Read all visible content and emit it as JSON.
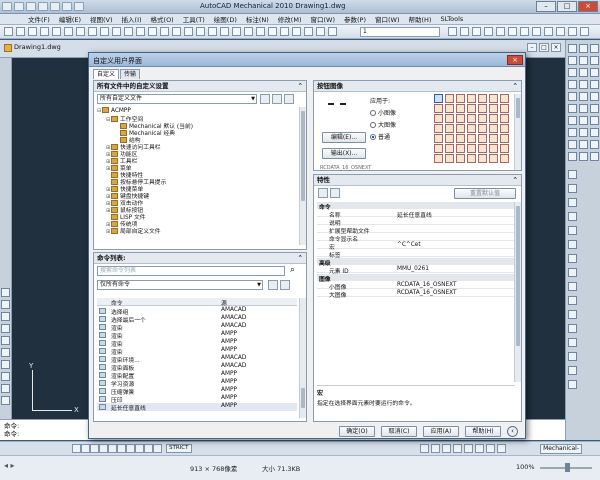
{
  "app": {
    "title": "AutoCAD Mechanical 2010   Drawing1.dwg",
    "search_placeholder": "",
    "menu": [
      "文件(F)",
      "编辑(E)",
      "视图(V)",
      "插入(I)",
      "格式(O)",
      "工具(T)",
      "绘图(D)",
      "标注(N)",
      "修改(M)",
      "窗口(W)",
      "参数(P)",
      "窗口(W)",
      "帮助(H)",
      "SLTools"
    ],
    "toolbar_combo": "1"
  },
  "document": {
    "tab": "Drawing1.dwg"
  },
  "command_line": {
    "lines": [
      "命令:",
      "命令:"
    ]
  },
  "status": {
    "coord": "",
    "strict": "STRICT",
    "model": "Mechanical-"
  },
  "viewer": {
    "dims": "913 × 768像素",
    "size": "大小 71.3KB",
    "zoom": "100%"
  },
  "dialog": {
    "title": "自定义用户界面",
    "tabs": [
      "自定义",
      "传输"
    ],
    "left_top": {
      "header": "所有文件中的自定义设置",
      "select": "所有自定义文件",
      "tree": [
        {
          "label": "ACMPP",
          "level": 0,
          "exp": "⊟"
        },
        {
          "label": "工作空间",
          "level": 1,
          "exp": "⊟"
        },
        {
          "label": "Mechanical 默认 (当前)",
          "level": 2,
          "exp": ""
        },
        {
          "label": "Mechanical 经典",
          "level": 2,
          "exp": ""
        },
        {
          "label": "结构",
          "level": 2,
          "exp": ""
        },
        {
          "label": "快速访问工具栏",
          "level": 1,
          "exp": "⊞"
        },
        {
          "label": "功能区",
          "level": 1,
          "exp": "⊞"
        },
        {
          "label": "工具栏",
          "level": 1,
          "exp": "⊞"
        },
        {
          "label": "菜单",
          "level": 1,
          "exp": "⊞"
        },
        {
          "label": "快捷特性",
          "level": 1,
          "exp": ""
        },
        {
          "label": "按标悬停工具提示",
          "level": 1,
          "exp": ""
        },
        {
          "label": "快捷菜单",
          "level": 1,
          "exp": "⊞"
        },
        {
          "label": "键盘快捷键",
          "level": 1,
          "exp": "⊞"
        },
        {
          "label": "双击动作",
          "level": 1,
          "exp": "⊞"
        },
        {
          "label": "鼠标按钮",
          "level": 1,
          "exp": "⊞"
        },
        {
          "label": "LISP 文件",
          "level": 1,
          "exp": ""
        },
        {
          "label": "传统项",
          "level": 1,
          "exp": "⊞"
        },
        {
          "label": "局部自定义文件",
          "level": 1,
          "exp": "⊞"
        }
      ]
    },
    "left_bottom": {
      "header": "命令列表:",
      "search_placeholder": "搜索命令列表",
      "filter": "仅所有命令",
      "col_command": "命令",
      "col_source": "源",
      "rows": [
        {
          "cmd": "选择组",
          "src": "AMACAD"
        },
        {
          "cmd": "选择最后一个",
          "src": "AMACAD"
        },
        {
          "cmd": "渲染",
          "src": "AMACAD"
        },
        {
          "cmd": "渲染",
          "src": "AMPP"
        },
        {
          "cmd": "渲染",
          "src": "AMPP"
        },
        {
          "cmd": "渲染",
          "src": "AMPP"
        },
        {
          "cmd": "渲染环境...",
          "src": "AMACAD"
        },
        {
          "cmd": "渲染面板",
          "src": "AMACAD"
        },
        {
          "cmd": "渲染配置",
          "src": "AMPP"
        },
        {
          "cmd": "学习资源",
          "src": "AMPP"
        },
        {
          "cmd": "压缩弹簧",
          "src": "AMPP"
        },
        {
          "cmd": "压印",
          "src": "AMPP"
        },
        {
          "cmd": "延长任意直线",
          "src": "AMPP"
        }
      ]
    },
    "button_image": {
      "header": "按钮图像",
      "apply_to": "应用于:",
      "radios": [
        "小图像",
        "大图像",
        "普通"
      ],
      "edit": "编辑(E)...",
      "export": "输出(X)...",
      "icon_label": "RCDATA_16_OSNEXT"
    },
    "properties": {
      "header": "特性",
      "reset": "重置默认值",
      "rows": [
        {
          "type": "cat",
          "name": "命令",
          "value": ""
        },
        {
          "type": "prop",
          "name": "名称",
          "value": "延长任意直线"
        },
        {
          "type": "prop",
          "name": "说明",
          "value": ""
        },
        {
          "type": "prop",
          "name": "扩展型帮助文件",
          "value": ""
        },
        {
          "type": "prop",
          "name": "命令显示名",
          "value": ""
        },
        {
          "type": "prop",
          "name": "宏",
          "value": "^C^Cet"
        },
        {
          "type": "prop",
          "name": "标签",
          "value": ""
        },
        {
          "type": "cat",
          "name": "高级",
          "value": ""
        },
        {
          "type": "prop",
          "name": "元素 ID",
          "value": "MMU_0261"
        },
        {
          "type": "cat",
          "name": "图像",
          "value": ""
        },
        {
          "type": "prop",
          "name": "小图像",
          "value": "RCDATA_16_OSNEXT"
        },
        {
          "type": "prop",
          "name": "大图像",
          "value": "RCDATA_16_OSNEXT"
        }
      ],
      "desc_title": "宏",
      "desc_text": "指定在选择界面元素时要运行的命令。"
    },
    "buttons": {
      "ok": "确定(O)",
      "cancel": "取消(C)",
      "apply": "应用(A)",
      "help": "帮助(H)"
    }
  }
}
